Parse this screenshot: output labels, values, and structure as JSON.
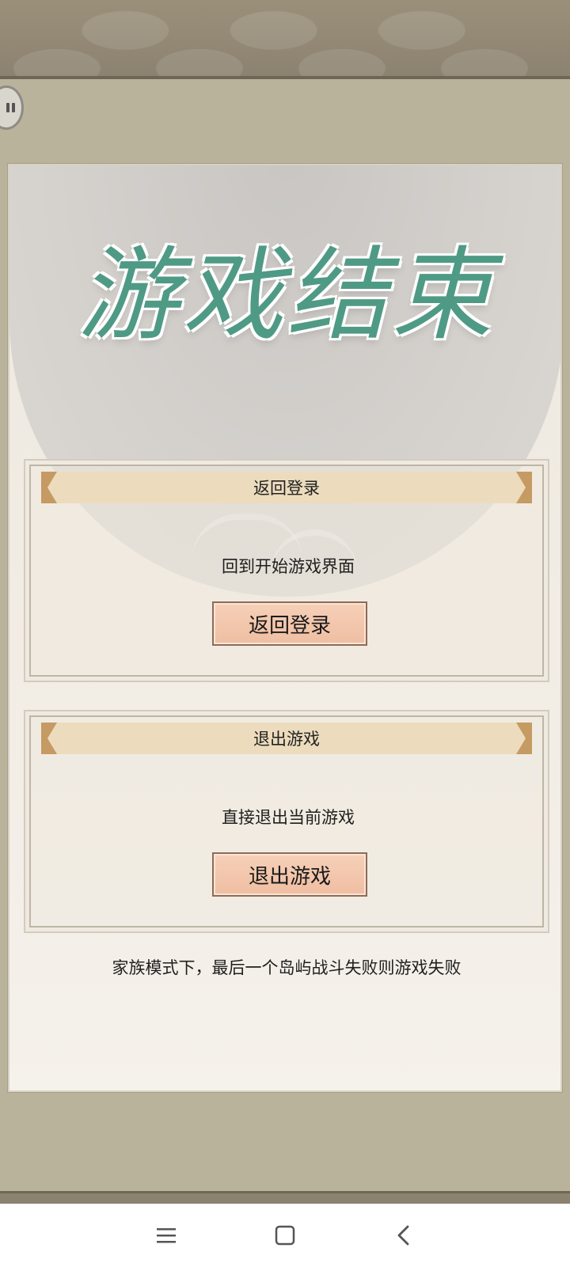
{
  "game": {
    "title": "游戏结束",
    "sections": [
      {
        "header": "返回登录",
        "description": "回到开始游戏界面",
        "button_label": "返回登录"
      },
      {
        "header": "退出游戏",
        "description": "直接退出当前游戏",
        "button_label": "退出游戏"
      }
    ],
    "footer_note": "家族模式下，最后一个岛屿战斗失败则游戏失败"
  },
  "icons": {
    "pause": "pause-icon",
    "nav_menu": "menu-icon",
    "nav_home": "home-icon",
    "nav_back": "back-icon"
  },
  "colors": {
    "title": "#4f9a85",
    "header_band": "#ecdcbd",
    "button": "#f3c6ab"
  }
}
